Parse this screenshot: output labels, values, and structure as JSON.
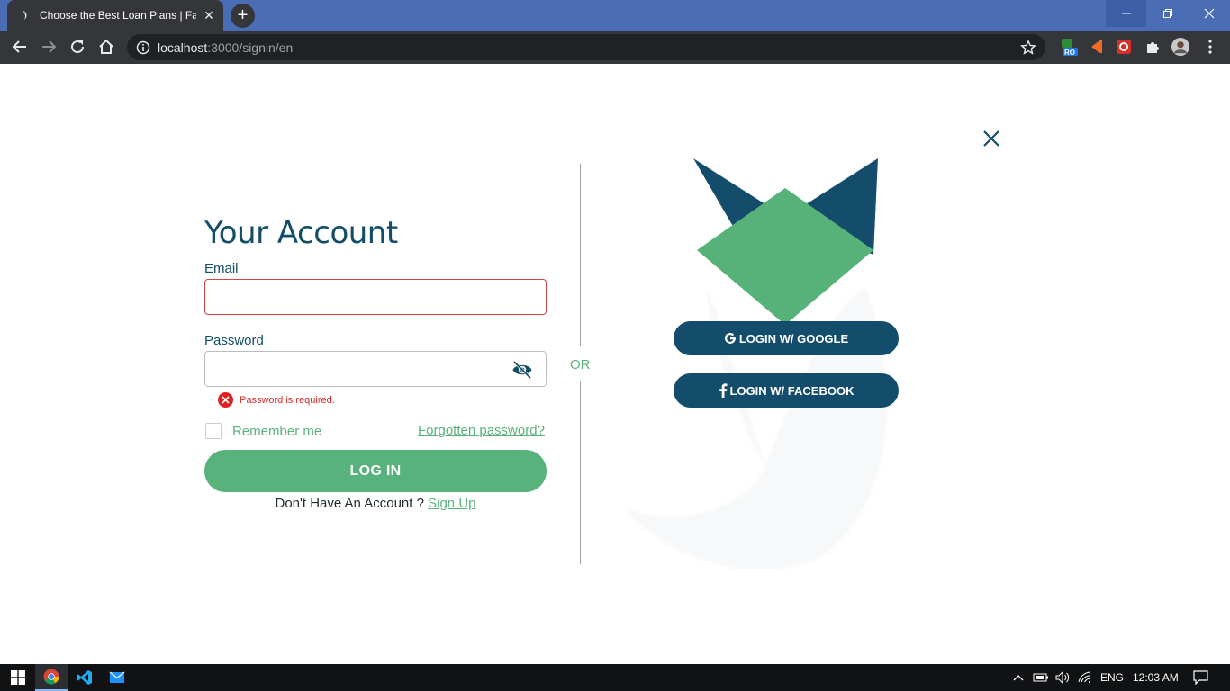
{
  "browser": {
    "tab_title": "Choose the Best Loan Plans | Fay",
    "new_tab_label": "+",
    "url_host": "localhost",
    "url_path": ":3000/signin/en",
    "ext_badge": "RO"
  },
  "page": {
    "heading": "Your Account",
    "email_label": "Email",
    "email_value": "",
    "password_label": "Password",
    "password_value": "",
    "password_error": "Password is required.",
    "remember_label": "Remember me",
    "remember_checked": false,
    "forgot_label": "Forgotten password?",
    "login_label": "LOG IN",
    "no_account_text": "Don't Have An Account ?",
    "signup_label": "Sign Up",
    "or_label": "OR",
    "google_label": "LOGIN W/ GOOGLE",
    "facebook_label": "LOGIN W/ FACEBOOK"
  },
  "taskbar": {
    "language": "ENG",
    "time": "12:03 AM"
  },
  "colors": {
    "brand_dark": "#134d6b",
    "brand_green": "#58b27b",
    "error": "#d62b2b",
    "chrome_frame": "#4a6db5",
    "chrome_toolbar": "#35363a"
  }
}
